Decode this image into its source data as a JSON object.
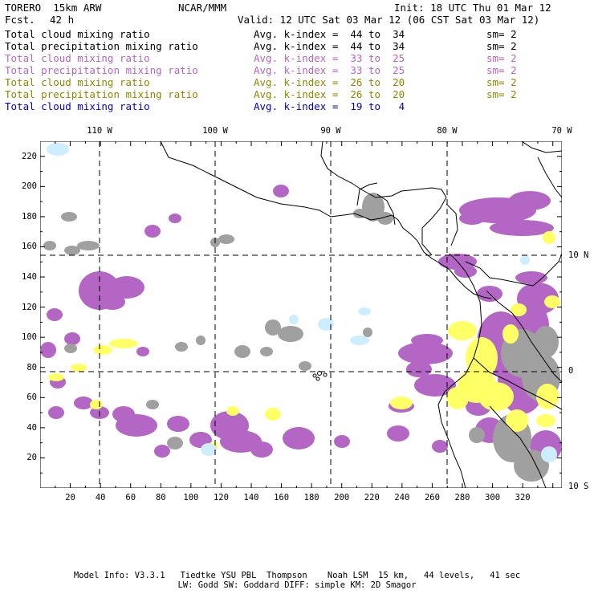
{
  "header": {
    "model": "TORERO  15km ARW",
    "org": "NCAR/MMM",
    "init": "Init: 18 UTC Thu 01 Mar 12",
    "fcst_label": "Fcst.",
    "fcst_value": "42 h",
    "valid": "Valid: 12 UTC Sat 03 Mar 12 (06 CST Sat 03 Mar 12)"
  },
  "legend_rows": [
    {
      "field": "Total cloud mixing ratio",
      "index": "Avg. k-index =  44 to  34",
      "sm": "sm= 2",
      "color": "#000000"
    },
    {
      "field": "Total precipitation mixing ratio",
      "index": "Avg. k-index =  44 to  34",
      "sm": "sm= 2",
      "color": "#000000"
    },
    {
      "field": "Total cloud mixing ratio",
      "index": "Avg. k-index =  33 to  25",
      "sm": "sm= 2",
      "color": "#b366c4"
    },
    {
      "field": "Total precipitation mixing ratio",
      "index": "Avg. k-index =  33 to  25",
      "sm": "sm= 2",
      "color": "#b366c4"
    },
    {
      "field": "Total cloud mixing ratio",
      "index": "Avg. k-index =  26 to  20",
      "sm": "sm= 2",
      "color": "#8a8a00"
    },
    {
      "field": "Total precipitation mixing ratio",
      "index": "Avg. k-index =  26 to  20",
      "sm": "sm= 2",
      "color": "#8a8a00"
    },
    {
      "field": "Total cloud mixing ratio",
      "index": "Avg. k-index =  19 to   4",
      "sm": "",
      "color": "#0000cc"
    }
  ],
  "map": {
    "top_lon_labels": [
      "110 W",
      "100 W",
      "90 W",
      "80 W",
      "70 W"
    ],
    "right_lat_labels": [
      "10 N",
      "0",
      "10 S"
    ],
    "y_ticks": [
      "220",
      "200",
      "180",
      "160",
      "140",
      "120",
      "100",
      "80",
      "60",
      "40",
      "20"
    ],
    "x_ticks": [
      "20",
      "40",
      "60",
      "80",
      "100",
      "120",
      "140",
      "160",
      "180",
      "200",
      "220",
      "240",
      "260",
      "280",
      "300",
      "320"
    ],
    "colors": {
      "gray": "#a0a0a0",
      "purple": "#b366c4",
      "yellow": "#ffff66",
      "lightblue": "#cceeff"
    }
  },
  "footer": {
    "line1": "Model Info: V3.3.1   Tiedtke YSU PBL  Thompson    Noah LSM  15 km,   44 levels,   41 sec",
    "line2": "LW: Godd SW: Goddard DIFF: simple KM: 2D Smagor"
  }
}
